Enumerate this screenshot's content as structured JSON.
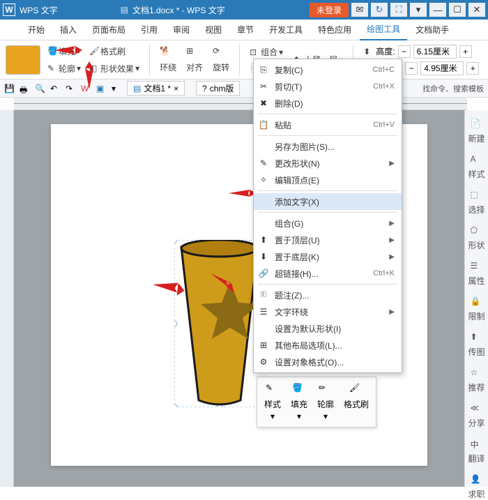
{
  "titlebar": {
    "app_name": "WPS 文字",
    "doc_name": "文档1.docx * - WPS 文字",
    "login_pill": "未登录"
  },
  "menubar": {
    "tabs": [
      "开始",
      "插入",
      "页面布局",
      "引用",
      "审阅",
      "视图",
      "章节",
      "开发工具",
      "特色应用",
      "绘图工具",
      "文档助手"
    ],
    "active_index": 9
  },
  "toolbar": {
    "fill": "填充",
    "format_painter": "格式刷",
    "outline": "轮廓",
    "shape_effect": "形状效果",
    "wrap": "环绕",
    "align": "对齐",
    "rotate": "旋转",
    "group": "组合",
    "up_layer": "上移一层",
    "height_label": "高度:",
    "height_value": "6.15厘米",
    "width_value": "4.95厘米"
  },
  "qat": {
    "doc_tab1": "文档1 *",
    "doc_tab2": "chm版",
    "hint": "找命令、搜索模板"
  },
  "context_menu": {
    "items": [
      {
        "icon": "copy",
        "label": "复制(C)",
        "shortcut": "Ctrl+C"
      },
      {
        "icon": "cut",
        "label": "剪切(T)",
        "shortcut": "Ctrl+X"
      },
      {
        "icon": "delete",
        "label": "删除(D)"
      },
      {
        "sep": true
      },
      {
        "icon": "paste",
        "label": "粘贴",
        "shortcut": "Ctrl+V"
      },
      {
        "sep": true
      },
      {
        "label": "另存为图片(S)..."
      },
      {
        "icon": "edit-shape",
        "label": "更改形状(N)",
        "sub": true
      },
      {
        "icon": "edit-points",
        "label": "编辑顶点(E)"
      },
      {
        "sep": true
      },
      {
        "label": "添加文字(X)",
        "hover": true
      },
      {
        "sep": true
      },
      {
        "label": "组合(G)",
        "sub": true
      },
      {
        "icon": "bring-front",
        "label": "置于顶层(U)",
        "sub": true
      },
      {
        "icon": "send-back",
        "label": "置于底层(K)",
        "sub": true
      },
      {
        "icon": "link",
        "label": "超链接(H)...",
        "shortcut": "Ctrl+K"
      },
      {
        "sep": true
      },
      {
        "icon": "caption",
        "label": "题注(Z)..."
      },
      {
        "icon": "text-wrap",
        "label": "文字环绕",
        "sub": true
      },
      {
        "label": "设置为默认形状(I)"
      },
      {
        "icon": "layout",
        "label": "其他布局选项(L)..."
      },
      {
        "icon": "format",
        "label": "设置对象格式(O)..."
      }
    ]
  },
  "float_toolbar": {
    "items": [
      "样式",
      "填充",
      "轮廓",
      "格式刷"
    ]
  },
  "side_panel": {
    "items": [
      "新建",
      "样式",
      "选择",
      "形状",
      "属性",
      "限制",
      "传图",
      "推荐",
      "分享",
      "翻译",
      "求职"
    ]
  }
}
